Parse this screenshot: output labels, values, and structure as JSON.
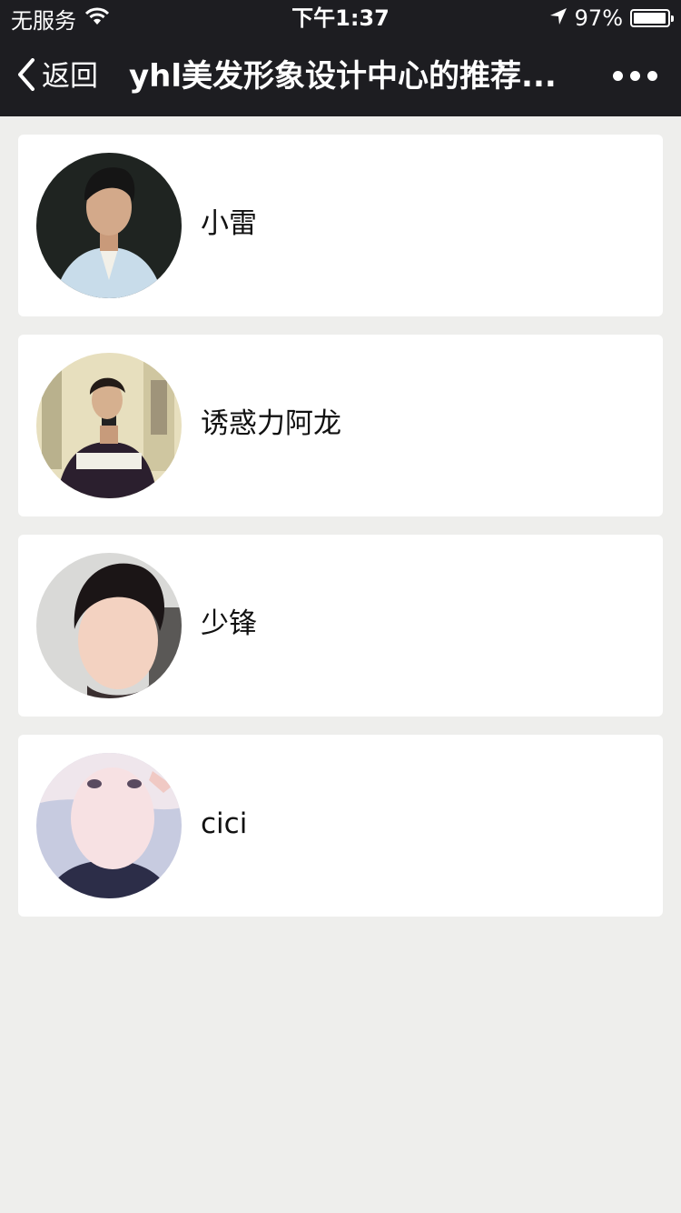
{
  "status_bar": {
    "carrier": "无服务",
    "time": "下午1:37",
    "battery": "97%",
    "battery_level": 0.97
  },
  "nav": {
    "back_label": "返回",
    "title": "yhl美发形象设计中心的推荐..."
  },
  "stylists": [
    {
      "name": "小雷"
    },
    {
      "name": "诱惑力阿龙"
    },
    {
      "name": "少锋"
    },
    {
      "name": "cici"
    }
  ]
}
